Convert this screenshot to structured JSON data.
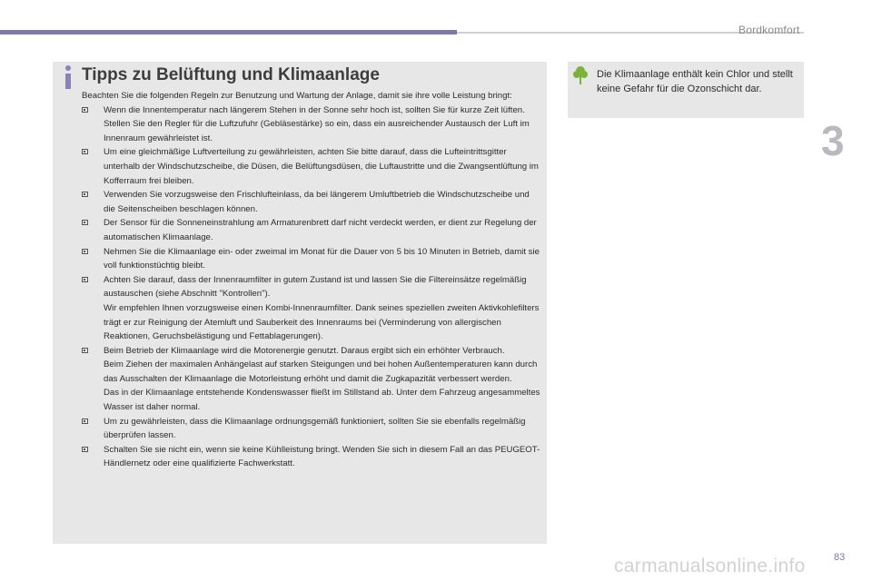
{
  "header": {
    "section_title": "Bordkomfort",
    "chapter_number": "3"
  },
  "main": {
    "title": "Tipps zu Belüftung und Klimaanlage",
    "intro": "Beachten Sie die folgenden Regeln zur Benutzung und Wartung der Anlage, damit sie ihre volle Leistung bringt:",
    "bullets": [
      {
        "paragraphs": [
          "Wenn die Innentemperatur nach längerem Stehen in der Sonne sehr hoch ist, sollten Sie für kurze Zeit lüften.",
          "Stellen Sie den Regler für die Luftzufuhr (Gebläsestärke) so ein, dass ein ausreichender Austausch der Luft im Innenraum gewährleistet ist."
        ]
      },
      {
        "paragraphs": [
          "Um eine gleichmäßige Luftverteilung zu gewährleisten, achten Sie bitte darauf, dass die Lufteintrittsgitter unterhalb der Windschutzscheibe, die Düsen, die Belüftungsdüsen, die Luftaustritte und die Zwangsentlüftung im Kofferraum frei bleiben."
        ]
      },
      {
        "paragraphs": [
          "Verwenden Sie vorzugsweise den Frischlufteinlass, da bei längerem Umluftbetrieb die Windschutzscheibe und die Seitenscheiben beschlagen können."
        ]
      },
      {
        "paragraphs": [
          "Der Sensor für die Sonneneinstrahlung am Armaturenbrett darf nicht verdeckt werden, er dient zur Regelung der automatischen Klimaanlage."
        ]
      },
      {
        "paragraphs": [
          "Nehmen Sie die Klimaanlage ein- oder zweimal im Monat für die Dauer von 5 bis 10 Minuten in Betrieb, damit sie voll funktionstüchtig bleibt."
        ]
      },
      {
        "paragraphs": [
          "Achten Sie darauf, dass der Innenraumfilter in gutem Zustand ist und lassen Sie die Filtereinsätze regelmäßig austauschen (siehe Abschnitt \"Kontrollen\").",
          "Wir empfehlen Ihnen vorzugsweise einen Kombi-Innenraumfilter. Dank seines speziellen zweiten Aktivkohlefilters trägt er zur Reinigung der Atemluft und Sauberkeit des Innenraums bei (Verminderung von allergischen Reaktionen, Geruchsbelästigung und Fettablagerungen)."
        ]
      },
      {
        "paragraphs": [
          "Beim Betrieb der Klimaanlage wird die Motorenergie genutzt. Daraus ergibt sich ein erhöhter Verbrauch.",
          "Beim Ziehen der maximalen Anhängelast auf starken Steigungen und bei hohen Außentemperaturen kann durch das Ausschalten der Klimaanlage die Motorleistung erhöht und damit die Zugkapazität verbessert werden.",
          "Das in der Klimaanlage entstehende Kondenswasser fließt im Stillstand ab. Unter dem Fahrzeug angesammeltes Wasser ist daher normal."
        ]
      },
      {
        "paragraphs": [
          "Um zu gewährleisten, dass die Klimaanlage ordnungsgemäß funktioniert, sollten Sie sie ebenfalls regelmäßig überprüfen lassen."
        ]
      },
      {
        "paragraphs": [
          "Schalten Sie sie nicht ein, wenn sie keine Kühlleistung bringt. Wenden Sie sich in diesem Fall an das PEUGEOT-Händlernetz oder eine qualifizierte Fachwerkstatt."
        ]
      }
    ]
  },
  "eco_note": {
    "text": "Die Klimaanlage enthält kein Chlor und stellt keine Gefahr für die Ozonschicht dar."
  },
  "footer": {
    "page_number": "83",
    "watermark": "carmanualsonline.info"
  },
  "colors": {
    "accent_purple": "#7f78a9",
    "eco_green": "#7bb23a",
    "box_grey": "#e7e7e7"
  }
}
